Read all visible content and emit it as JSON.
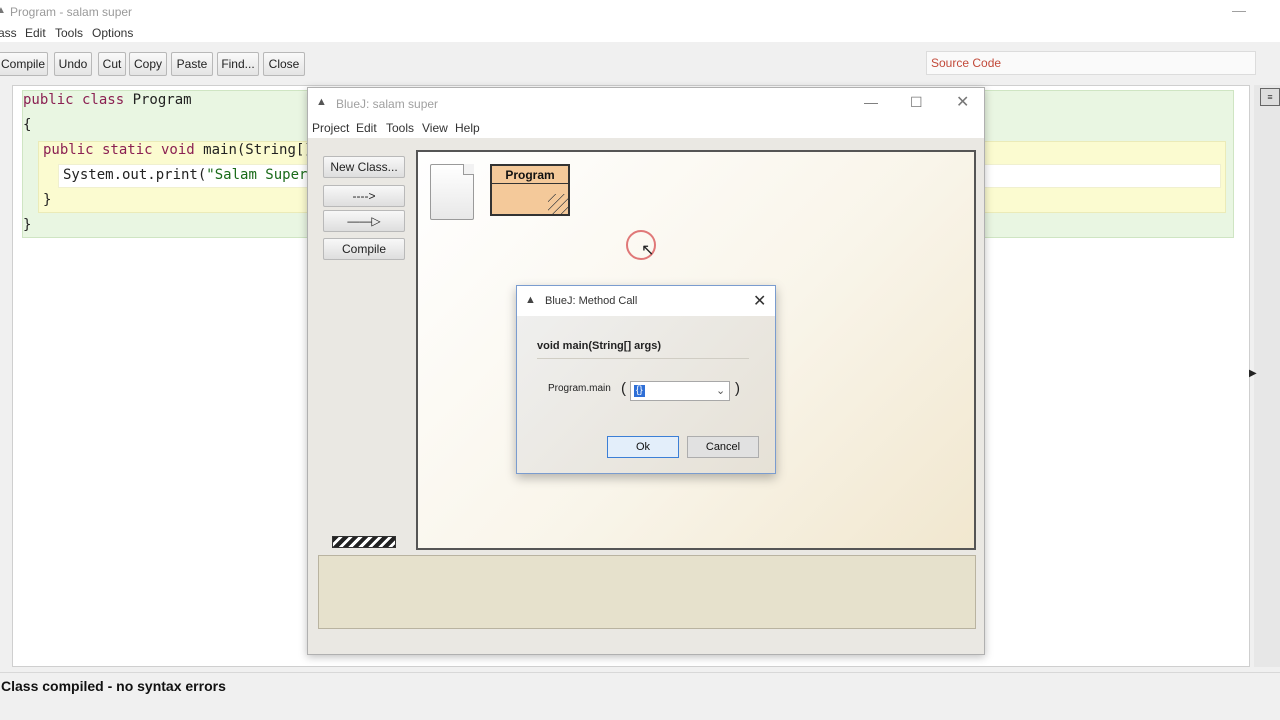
{
  "editor": {
    "title": "Program - salam super",
    "menu": [
      "ass",
      "Edit",
      "Tools",
      "Options"
    ],
    "toolbar": [
      "Compile",
      "Undo",
      "Cut",
      "Copy",
      "Paste",
      "Find...",
      "Close"
    ],
    "view_select": "Source Code",
    "code": {
      "line1_kw": "public class ",
      "line1_name": "Program",
      "line2": "{",
      "line3_kw": "public static void ",
      "line3_rest": "main(String[] ar",
      "line4_a": "System.out.print(",
      "line4_str": "\"Salam Super\"",
      "line5": "}",
      "line6": "}"
    },
    "status": "Class compiled - no syntax errors"
  },
  "project": {
    "title": "BlueJ:  salam super",
    "menu": [
      "Project",
      "Edit",
      "Tools",
      "View",
      "Help"
    ],
    "side_buttons": {
      "new_class": "New Class...",
      "dep_arrow": "---->",
      "inh_arrow": "——▷",
      "compile": "Compile"
    },
    "class_name": "Program"
  },
  "dialog": {
    "title": "BlueJ:  Method Call",
    "signature": "void main(String[] args)",
    "call_label": "Program.main",
    "open_paren": "(",
    "close_paren": ")",
    "arg_value": "{}",
    "ok": "Ok",
    "cancel": "Cancel"
  },
  "icons": {
    "app": "bluej-bird-icon",
    "close": "close-icon",
    "minimize": "minimize-icon",
    "maximize": "maximize-icon",
    "dropdown": "chevron-down-icon"
  }
}
